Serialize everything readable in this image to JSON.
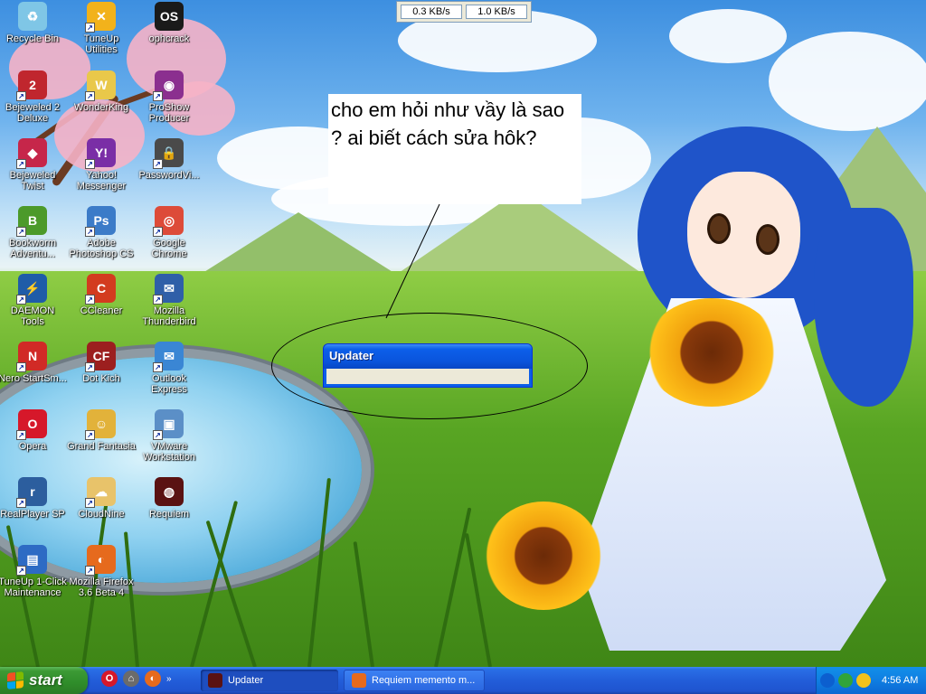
{
  "desktop": {
    "icons": [
      {
        "label": "Recycle Bin",
        "icon": "recycle-bin-icon",
        "color": "#7fc6e6",
        "glyph": "♻",
        "shortcut": false
      },
      {
        "label": "TuneUp Utilities",
        "icon": "tuneup-icon",
        "color": "#f2b21b",
        "glyph": "✕",
        "shortcut": true
      },
      {
        "label": "ophcrack",
        "icon": "ophcrack-icon",
        "color": "#1a1a1a",
        "glyph": "OS",
        "shortcut": false
      },
      {
        "label": "Bejeweled 2 Deluxe",
        "icon": "bejeweled-icon",
        "color": "#c0262e",
        "glyph": "2",
        "shortcut": true
      },
      {
        "label": "WonderKing",
        "icon": "wonderking-icon",
        "color": "#e9c84a",
        "glyph": "W",
        "shortcut": true
      },
      {
        "label": "ProShow Producer",
        "icon": "proshow-icon",
        "color": "#8b2f8f",
        "glyph": "◉",
        "shortcut": true
      },
      {
        "label": "Bejeweled Twist",
        "icon": "bejeweled-twist-icon",
        "color": "#c6264a",
        "glyph": "◆",
        "shortcut": true
      },
      {
        "label": "Yahoo! Messenger",
        "icon": "yahoo-messenger-icon",
        "color": "#7a2ea6",
        "glyph": "Y!",
        "shortcut": true
      },
      {
        "label": "PasswordVi...",
        "icon": "password-icon",
        "color": "#4a4a4a",
        "glyph": "🔒",
        "shortcut": true
      },
      {
        "label": "Bookworm Adventu...",
        "icon": "bookworm-icon",
        "color": "#4c9a2a",
        "glyph": "B",
        "shortcut": true
      },
      {
        "label": "Adobe Photoshop CS",
        "icon": "photoshop-icon",
        "color": "#3b7bc8",
        "glyph": "Ps",
        "shortcut": true
      },
      {
        "label": "Google Chrome",
        "icon": "chrome-icon",
        "color": "#dd4b39",
        "glyph": "◎",
        "shortcut": true
      },
      {
        "label": "DAEMON Tools",
        "icon": "daemon-tools-icon",
        "color": "#1f5ca8",
        "glyph": "⚡",
        "shortcut": true
      },
      {
        "label": "CCleaner",
        "icon": "ccleaner-icon",
        "color": "#d33b1f",
        "glyph": "C",
        "shortcut": true
      },
      {
        "label": "Mozilla Thunderbird",
        "icon": "thunderbird-icon",
        "color": "#2f5fa8",
        "glyph": "✉",
        "shortcut": true
      },
      {
        "label": "Nero StartSm...",
        "icon": "nero-icon",
        "color": "#d12a26",
        "glyph": "N",
        "shortcut": true
      },
      {
        "label": "Dot Kich",
        "icon": "dot-kich-icon",
        "color": "#9c1f1f",
        "glyph": "CF",
        "shortcut": true
      },
      {
        "label": "Outlook Express",
        "icon": "outlook-express-icon",
        "color": "#3a86d4",
        "glyph": "✉",
        "shortcut": true
      },
      {
        "label": "Opera",
        "icon": "opera-icon",
        "color": "#d6182a",
        "glyph": "O",
        "shortcut": true
      },
      {
        "label": "Grand Fantasia",
        "icon": "grand-fantasia-icon",
        "color": "#e2b23a",
        "glyph": "☺",
        "shortcut": true
      },
      {
        "label": "VMware Workstation",
        "icon": "vmware-icon",
        "color": "#5b8fc7",
        "glyph": "▣",
        "shortcut": true
      },
      {
        "label": "RealPlayer SP",
        "icon": "realplayer-icon",
        "color": "#2c5e9e",
        "glyph": "r",
        "shortcut": true
      },
      {
        "label": "CloudNine",
        "icon": "cloudnine-icon",
        "color": "#e8c36a",
        "glyph": "☁",
        "shortcut": true
      },
      {
        "label": "Requiem",
        "icon": "requiem-icon",
        "color": "#5a1212",
        "glyph": "◍",
        "shortcut": false
      },
      {
        "label": "TuneUp 1-Click Maintenance",
        "icon": "tuneup-1-click-icon",
        "color": "#2d6bc4",
        "glyph": "▤",
        "shortcut": true
      },
      {
        "label": "Mozilla Firefox 3.6 Beta 4",
        "icon": "firefox-icon",
        "color": "#e66a1d",
        "glyph": "◐",
        "shortcut": true
      }
    ]
  },
  "netmeter": {
    "down": "0.3 KB/s",
    "up": "1.0 KB/s"
  },
  "annotation": {
    "text": "cho em hỏi như vầy là sao ? ai biết cách sửa hôk?"
  },
  "updater_window": {
    "title": "Updater"
  },
  "taskbar": {
    "start_label": "start",
    "quicklaunch": [
      {
        "icon": "opera-icon",
        "color": "#d6182a",
        "glyph": "O"
      },
      {
        "icon": "network-icon",
        "color": "#6b6b6b",
        "glyph": "⌂"
      },
      {
        "icon": "firefox-icon",
        "color": "#e66a1d",
        "glyph": "◐"
      }
    ],
    "chevron": "»",
    "tasks": [
      {
        "label": "Updater",
        "icon": "requiem-icon",
        "color": "#5a1212"
      },
      {
        "label": "Requiem memento m...",
        "icon": "firefox-icon",
        "color": "#e66a1d"
      }
    ],
    "tray": {
      "icons": [
        {
          "icon": "chevron-left-icon",
          "color": "#0c5fcf"
        },
        {
          "icon": "network-arrows-icon",
          "color": "#31a43a"
        },
        {
          "icon": "yahoo-tray-icon",
          "color": "#f2c21b"
        }
      ],
      "clock": "4:56 AM"
    }
  }
}
